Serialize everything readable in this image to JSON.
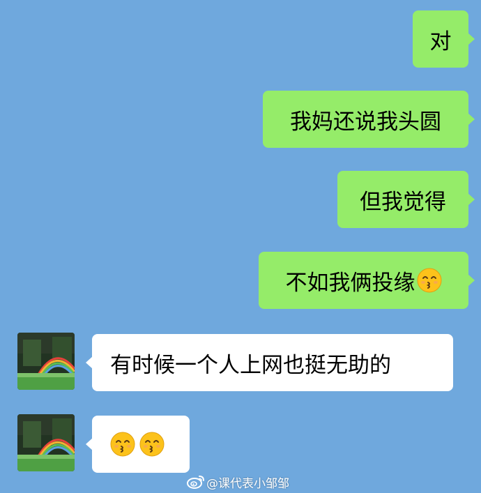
{
  "messages": [
    {
      "side": "out",
      "text": "对"
    },
    {
      "side": "out",
      "text": "我妈还说我头圆"
    },
    {
      "side": "out",
      "text": "但我觉得"
    },
    {
      "side": "out",
      "text": "不如我俩投缘",
      "emoji": "kissing-smiling-eyes"
    },
    {
      "side": "in",
      "text": "有时候一个人上网也挺无助的"
    },
    {
      "side": "in",
      "text": "",
      "emoji": "kissing-smiling-eyes",
      "emoji_count": 2
    }
  ],
  "colors": {
    "background": "#6fa8dd",
    "outgoing_bubble": "#95ec69",
    "incoming_bubble": "#ffffff"
  },
  "avatar": {
    "icon": "rainbow-garden-avatar"
  },
  "watermark": {
    "icon": "weibo-logo-icon",
    "text": "@课代表小邹邹"
  }
}
